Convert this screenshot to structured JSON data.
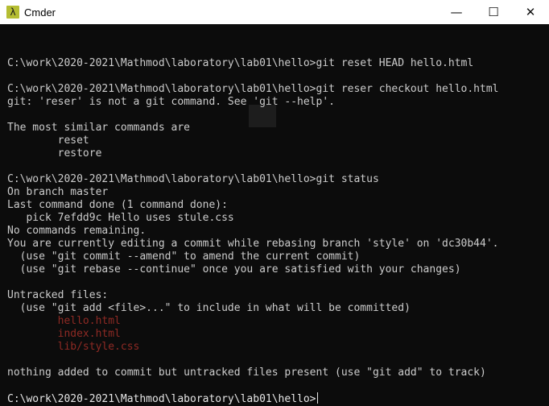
{
  "window": {
    "title": "Cmder",
    "app_icon_glyph": "λ",
    "controls": {
      "minimize_glyph": "—",
      "maximize_glyph": "☐",
      "close_glyph": "✕"
    }
  },
  "terminal": {
    "background_color": "#0c0c0c",
    "text_color": "#cccccc",
    "untracked_color": "#8f2a24",
    "lines": [
      {
        "text": "",
        "kind": "normal"
      },
      {
        "text": "C:\\work\\2020-2021\\Mathmod\\laboratory\\lab01\\hello>git reset HEAD hello.html",
        "kind": "normal"
      },
      {
        "text": "",
        "kind": "normal"
      },
      {
        "text": "C:\\work\\2020-2021\\Mathmod\\laboratory\\lab01\\hello>git reser checkout hello.html",
        "kind": "normal"
      },
      {
        "text": "git: 'reser' is not a git command. See 'git --help'.",
        "kind": "normal"
      },
      {
        "text": "",
        "kind": "normal"
      },
      {
        "text": "The most similar commands are",
        "kind": "normal"
      },
      {
        "text": "        reset",
        "kind": "normal"
      },
      {
        "text": "        restore",
        "kind": "normal"
      },
      {
        "text": "",
        "kind": "normal"
      },
      {
        "text": "C:\\work\\2020-2021\\Mathmod\\laboratory\\lab01\\hello>git status",
        "kind": "normal"
      },
      {
        "text": "On branch master",
        "kind": "normal"
      },
      {
        "text": "Last command done (1 command done):",
        "kind": "normal"
      },
      {
        "text": "   pick 7efdd9c Hello uses stule.css",
        "kind": "normal"
      },
      {
        "text": "No commands remaining.",
        "kind": "normal"
      },
      {
        "text": "You are currently editing a commit while rebasing branch 'style' on 'dc30b44'.",
        "kind": "normal"
      },
      {
        "text": "  (use \"git commit --amend\" to amend the current commit)",
        "kind": "normal"
      },
      {
        "text": "  (use \"git rebase --continue\" once you are satisfied with your changes)",
        "kind": "normal"
      },
      {
        "text": "",
        "kind": "normal"
      },
      {
        "text": "Untracked files:",
        "kind": "normal"
      },
      {
        "text": "  (use \"git add <file>...\" to include in what will be committed)",
        "kind": "normal"
      },
      {
        "text": "        hello.html",
        "kind": "untracked"
      },
      {
        "text": "        index.html",
        "kind": "untracked"
      },
      {
        "text": "        lib/style.css",
        "kind": "untracked"
      },
      {
        "text": "",
        "kind": "normal"
      },
      {
        "text": "nothing added to commit but untracked files present (use \"git add\" to track)",
        "kind": "normal"
      },
      {
        "text": "",
        "kind": "normal"
      }
    ],
    "prompt": "C:\\work\\2020-2021\\Mathmod\\laboratory\\lab01\\hello>"
  }
}
